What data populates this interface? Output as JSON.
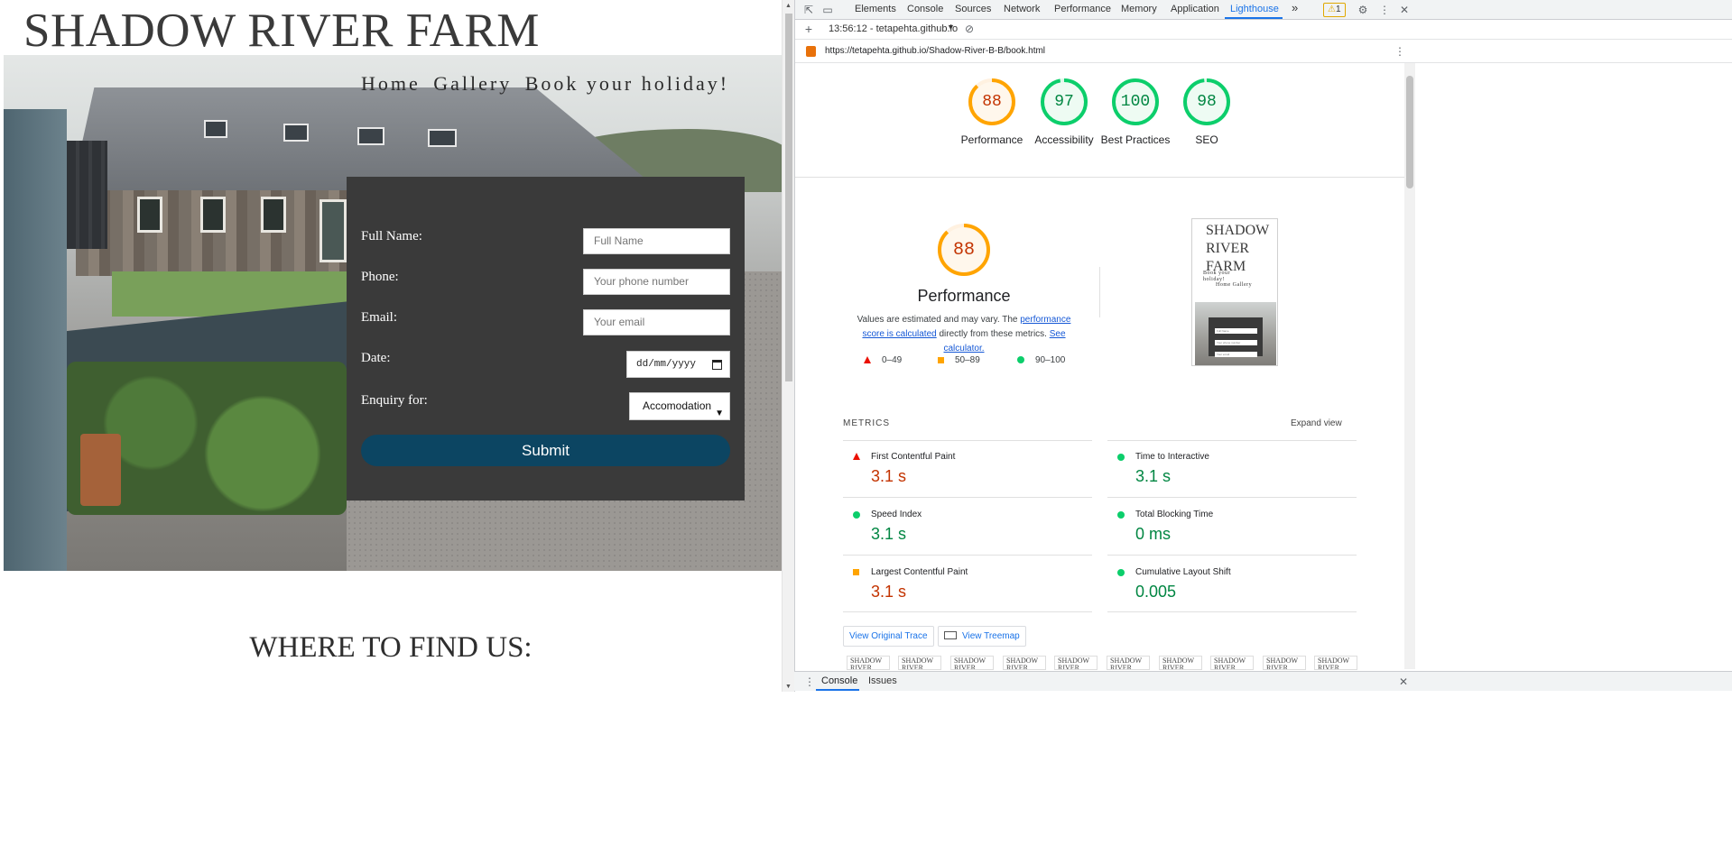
{
  "site": {
    "title": "SHADOW RIVER FARM",
    "nav": [
      "Home",
      "Gallery",
      "Book your holiday!"
    ],
    "form": {
      "full_name_label": "Full Name:",
      "full_name_placeholder": "Full Name",
      "phone_label": "Phone:",
      "phone_placeholder": "Your phone number",
      "email_label": "Email:",
      "email_placeholder": "Your email",
      "date_label": "Date:",
      "date_value": "dd/mm/yyyy",
      "enquiry_label": "Enquiry for:",
      "enquiry_selected": "Accomodation",
      "submit_label": "Submit"
    },
    "find_us_heading": "WHERE TO FIND US:"
  },
  "devtools": {
    "tabs": [
      "Elements",
      "Console",
      "Sources",
      "Network",
      "Performance",
      "Memory",
      "Application",
      "Lighthouse"
    ],
    "active_tab": "Lighthouse",
    "more_tabs": "»",
    "warning_count": "1",
    "report_selector": "13:56:12 - tetapehta.github.io",
    "url": "https://tetapehta.github.io/Shadow-River-B-B/book.html",
    "scores": [
      {
        "label": "Performance",
        "value": 88,
        "color": "#ffa400"
      },
      {
        "label": "Accessibility",
        "value": 97,
        "color": "#0cce6b"
      },
      {
        "label": "Best Practices",
        "value": 100,
        "color": "#0cce6b"
      },
      {
        "label": "SEO",
        "value": 98,
        "color": "#0cce6b"
      }
    ],
    "performance": {
      "score": 88,
      "title": "Performance",
      "note_prefix": "Values are estimated and may vary. The",
      "note_link1": "performance score is calculated",
      "note_middle": "directly from these metrics.",
      "note_link2": "See calculator.",
      "legend": [
        "0–49",
        "50–89",
        "90–100"
      ]
    },
    "screenshot": {
      "title": "SHADOW RIVER FARM",
      "nav1": "Book your holiday!",
      "nav2": "Home Gallery",
      "fields": [
        "Full Name",
        "Your phone number",
        "Your email"
      ]
    },
    "metrics_heading": "METRICS",
    "expand_view": "Expand view",
    "metrics": [
      {
        "name": "First Contentful Paint",
        "value": "3.1 s",
        "status": "fail",
        "color": "#c33300"
      },
      {
        "name": "Time to Interactive",
        "value": "3.1 s",
        "status": "pass",
        "color": "#018642"
      },
      {
        "name": "Speed Index",
        "value": "3.1 s",
        "status": "pass",
        "color": "#018642"
      },
      {
        "name": "Total Blocking Time",
        "value": "0 ms",
        "status": "pass",
        "color": "#018642"
      },
      {
        "name": "Largest Contentful Paint",
        "value": "3.1 s",
        "status": "average",
        "color": "#c33300"
      },
      {
        "name": "Cumulative Layout Shift",
        "value": "0.005",
        "status": "pass",
        "color": "#018642"
      }
    ],
    "view_trace": "View Original Trace",
    "view_treemap": "View Treemap",
    "filmstrip_label": "SHADOW RIVER",
    "drawer_tabs": [
      "Console",
      "Issues"
    ]
  }
}
